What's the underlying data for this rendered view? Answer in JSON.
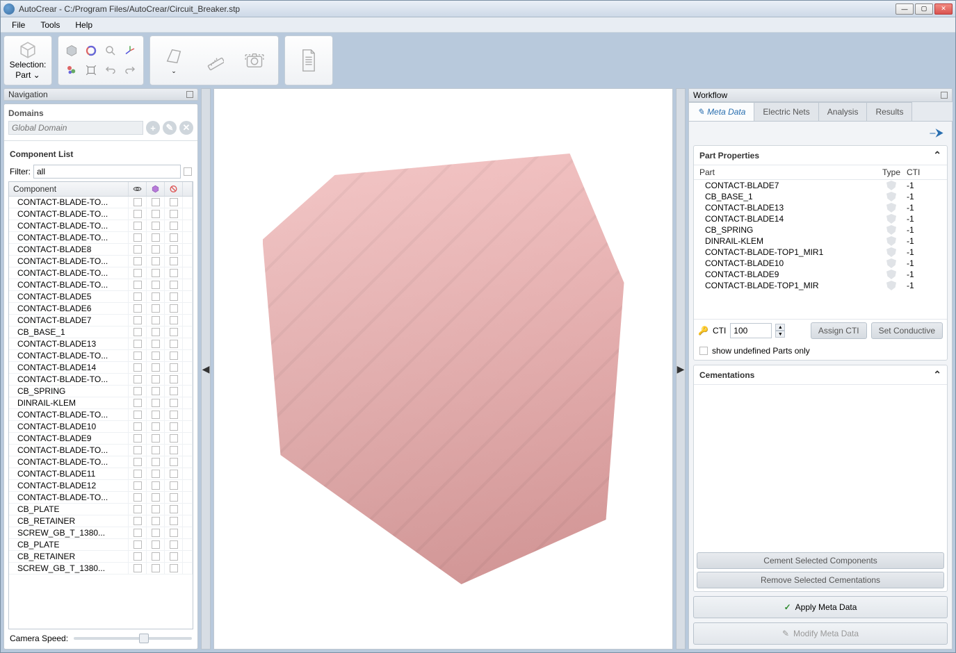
{
  "title": "AutoCrear - C:/Program Files/AutoCrear/Circuit_Breaker.stp",
  "menu": {
    "file": "File",
    "tools": "Tools",
    "help": "Help"
  },
  "selection": {
    "label1": "Selection:",
    "label2": "Part"
  },
  "navigation": {
    "header": "Navigation",
    "domains_title": "Domains",
    "global_domain_placeholder": "Global Domain",
    "component_list_title": "Component List",
    "filter_label": "Filter:",
    "filter_value": "all",
    "component_header": "Component",
    "camera_speed": "Camera Speed:",
    "components": [
      "CONTACT-BLADE-TO...",
      "CONTACT-BLADE-TO...",
      "CONTACT-BLADE-TO...",
      "CONTACT-BLADE-TO...",
      "CONTACT-BLADE8",
      "CONTACT-BLADE-TO...",
      "CONTACT-BLADE-TO...",
      "CONTACT-BLADE-TO...",
      "CONTACT-BLADE5",
      "CONTACT-BLADE6",
      "CONTACT-BLADE7",
      "CB_BASE_1",
      "CONTACT-BLADE13",
      "CONTACT-BLADE-TO...",
      "CONTACT-BLADE14",
      "CONTACT-BLADE-TO...",
      "CB_SPRING",
      "DINRAIL-KLEM",
      "CONTACT-BLADE-TO...",
      "CONTACT-BLADE10",
      "CONTACT-BLADE9",
      "CONTACT-BLADE-TO...",
      "CONTACT-BLADE-TO...",
      "CONTACT-BLADE11",
      "CONTACT-BLADE12",
      "CONTACT-BLADE-TO...",
      "CB_PLATE",
      "CB_RETAINER",
      "SCREW_GB_T_1380...",
      "CB_PLATE",
      "CB_RETAINER",
      "SCREW_GB_T_1380..."
    ]
  },
  "workflow": {
    "header": "Workflow",
    "tabs": {
      "meta": "Meta Data",
      "nets": "Electric Nets",
      "analysis": "Analysis",
      "results": "Results"
    },
    "part_properties": {
      "title": "Part Properties",
      "col_part": "Part",
      "col_type": "Type",
      "col_cti": "CTI",
      "rows": [
        {
          "part": "CONTACT-BLADE7",
          "cti": "-1"
        },
        {
          "part": "CB_BASE_1",
          "cti": "-1"
        },
        {
          "part": "CONTACT-BLADE13",
          "cti": "-1"
        },
        {
          "part": "CONTACT-BLADE14",
          "cti": "-1"
        },
        {
          "part": "CB_SPRING",
          "cti": "-1"
        },
        {
          "part": "DINRAIL-KLEM",
          "cti": "-1"
        },
        {
          "part": "CONTACT-BLADE-TOP1_MIR1",
          "cti": "-1"
        },
        {
          "part": "CONTACT-BLADE10",
          "cti": "-1"
        },
        {
          "part": "CONTACT-BLADE9",
          "cti": "-1"
        },
        {
          "part": "CONTACT-BLADE-TOP1_MIR",
          "cti": "-1"
        }
      ],
      "cti_label": "CTI",
      "cti_value": "100",
      "assign_btn": "Assign CTI",
      "conductive_btn": "Set Conductive",
      "show_undefined": "show undefined Parts only"
    },
    "cementations": {
      "title": "Cementations",
      "cement_btn": "Cement Selected Components",
      "remove_btn": "Remove Selected Cementations"
    },
    "apply_btn": "Apply Meta Data",
    "modify_btn": "Modify Meta Data"
  }
}
